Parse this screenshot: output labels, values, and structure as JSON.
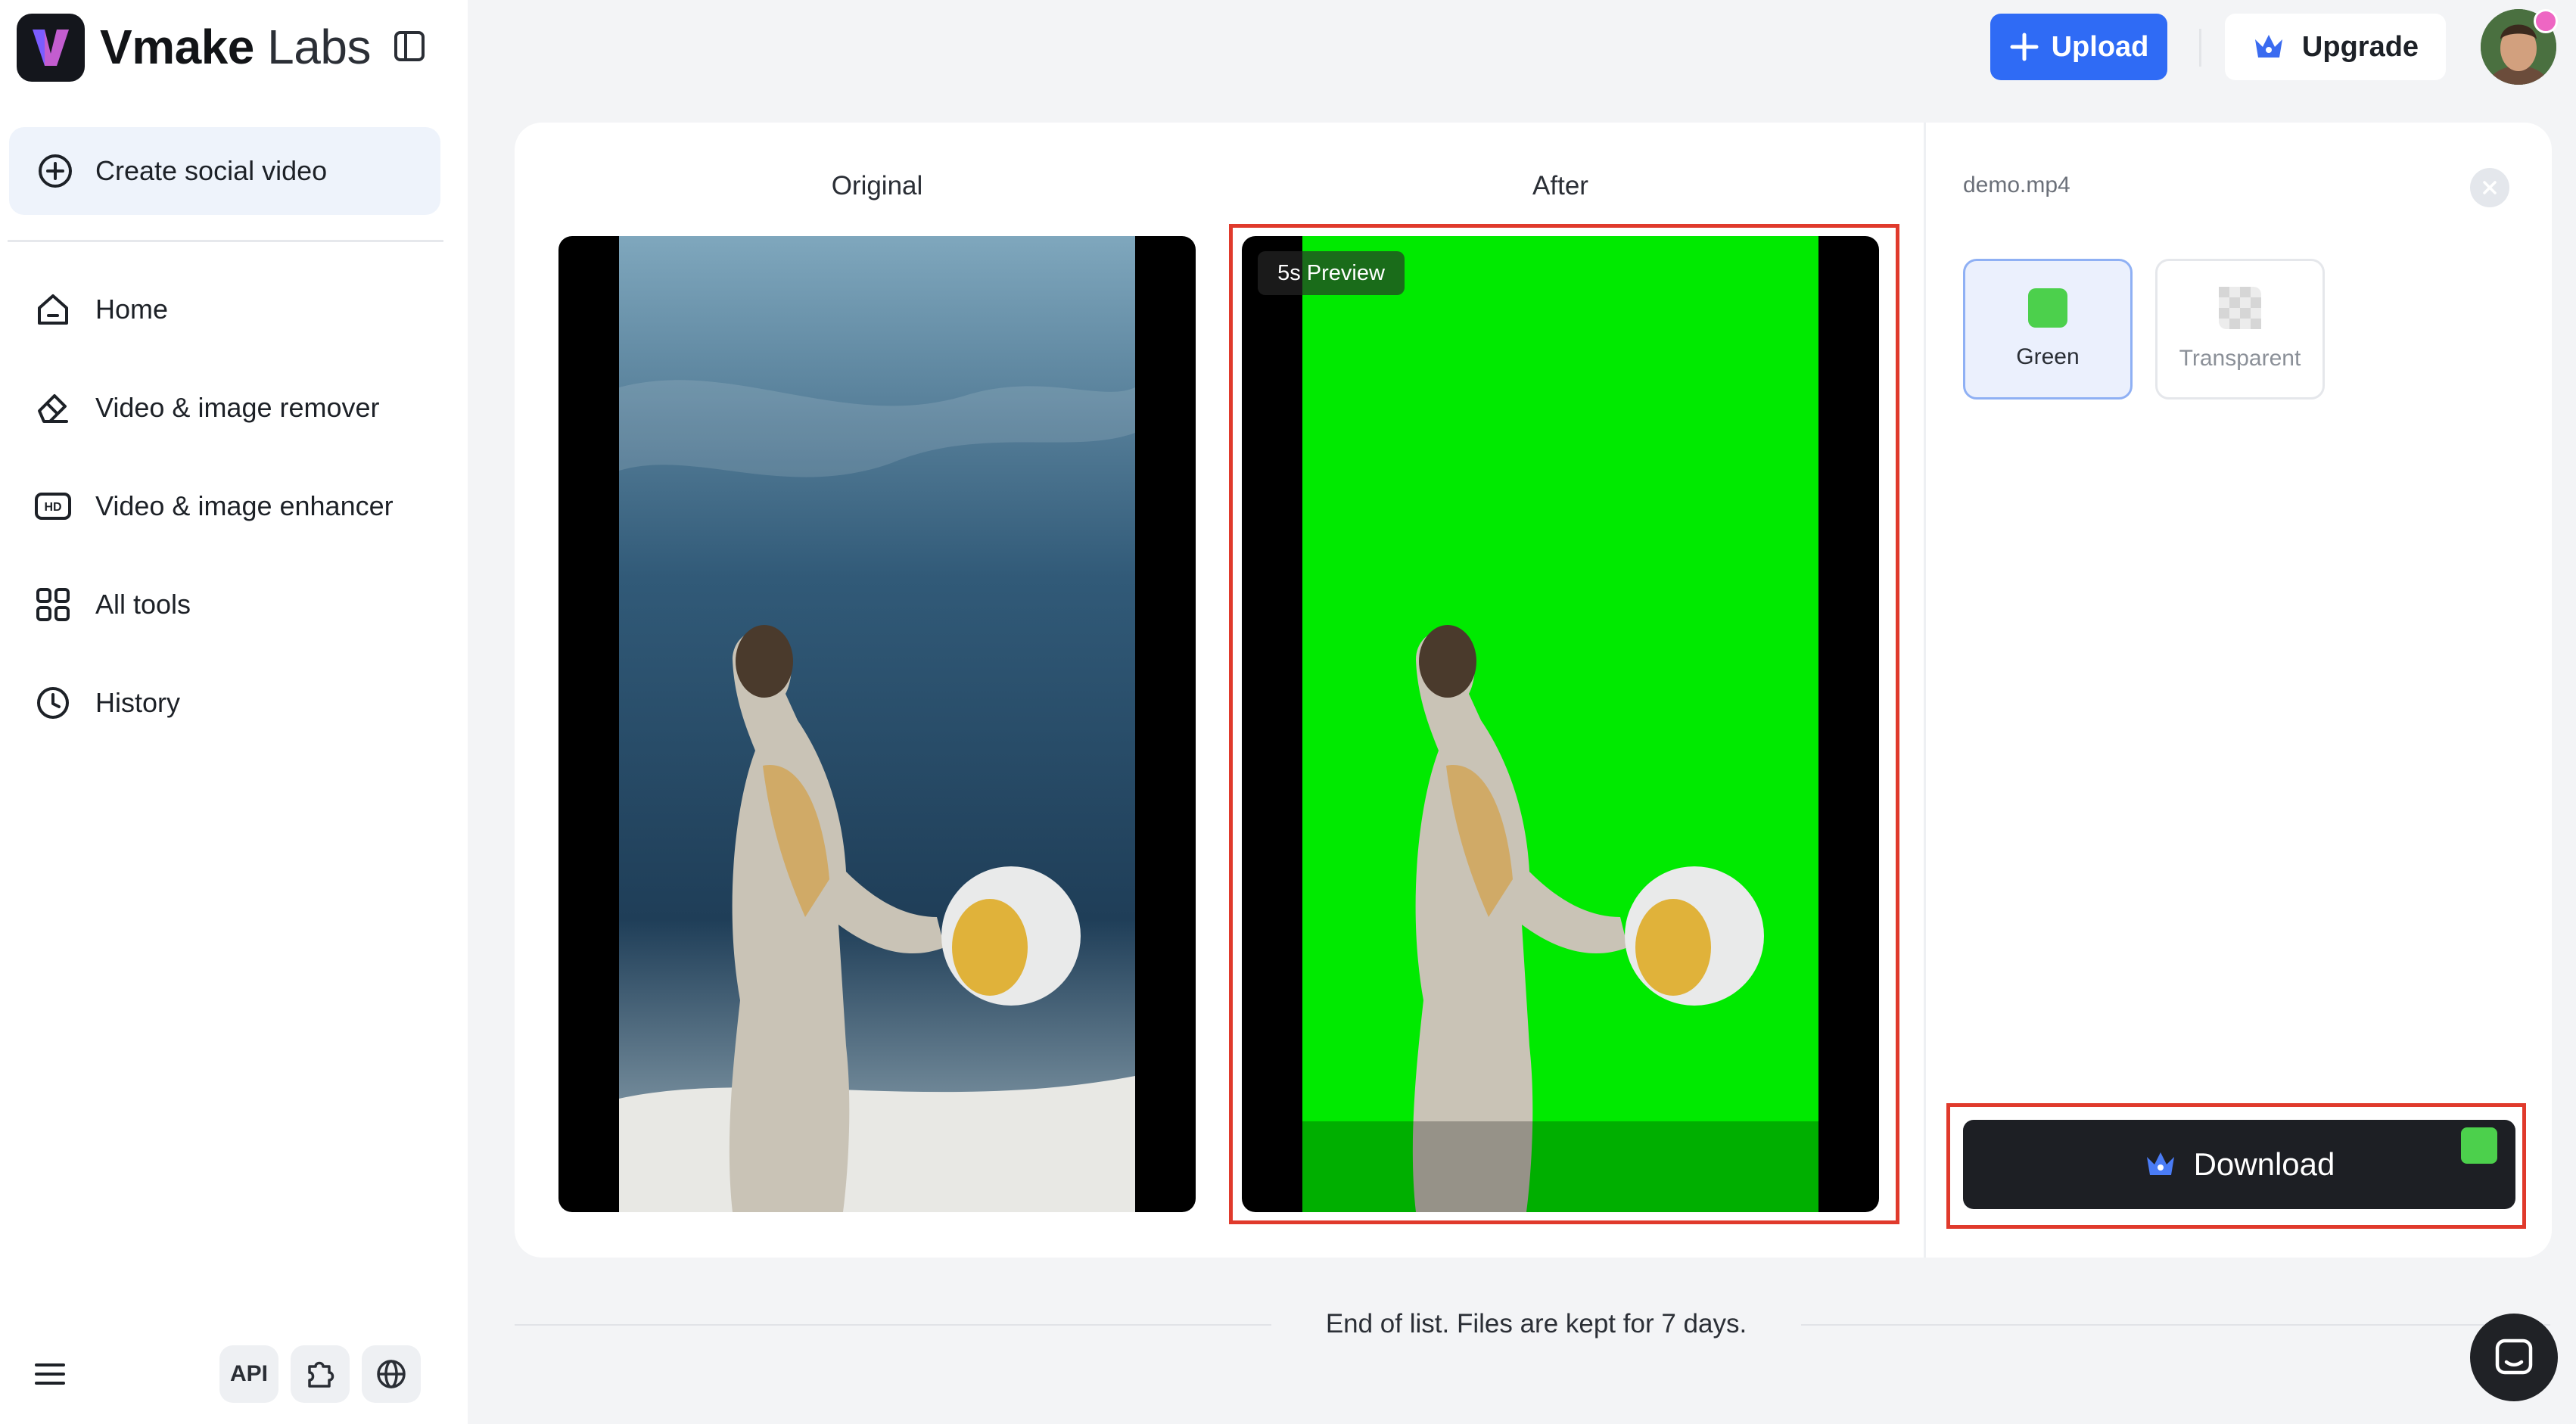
{
  "brand": {
    "bold": "Vmake",
    "light": "Labs"
  },
  "sidebar": {
    "create_label": "Create social video",
    "items": [
      {
        "label": "Home",
        "icon": "home-icon"
      },
      {
        "label": "Video & image remover",
        "icon": "eraser-icon"
      },
      {
        "label": "Video & image enhancer",
        "icon": "hd-icon"
      },
      {
        "label": "All tools",
        "icon": "grid-icon"
      },
      {
        "label": "History",
        "icon": "clock-icon"
      }
    ],
    "footer": {
      "api_label": "API"
    }
  },
  "header": {
    "upload_label": "Upload",
    "upgrade_label": "Upgrade"
  },
  "compare": {
    "original_title": "Original",
    "after_title": "After",
    "preview_badge": "5s Preview"
  },
  "panel": {
    "filename": "demo.mp4",
    "options": [
      {
        "label": "Green",
        "selected": true
      },
      {
        "label": "Transparent",
        "selected": false
      }
    ],
    "download_label": "Download"
  },
  "footer": {
    "end_text": "End of list. Files are kept for 7 days."
  },
  "colors": {
    "accent": "#2f6bf5",
    "green_screen": "#00ea00",
    "highlight": "#e03a2c",
    "dark_button": "#1d1f24"
  }
}
